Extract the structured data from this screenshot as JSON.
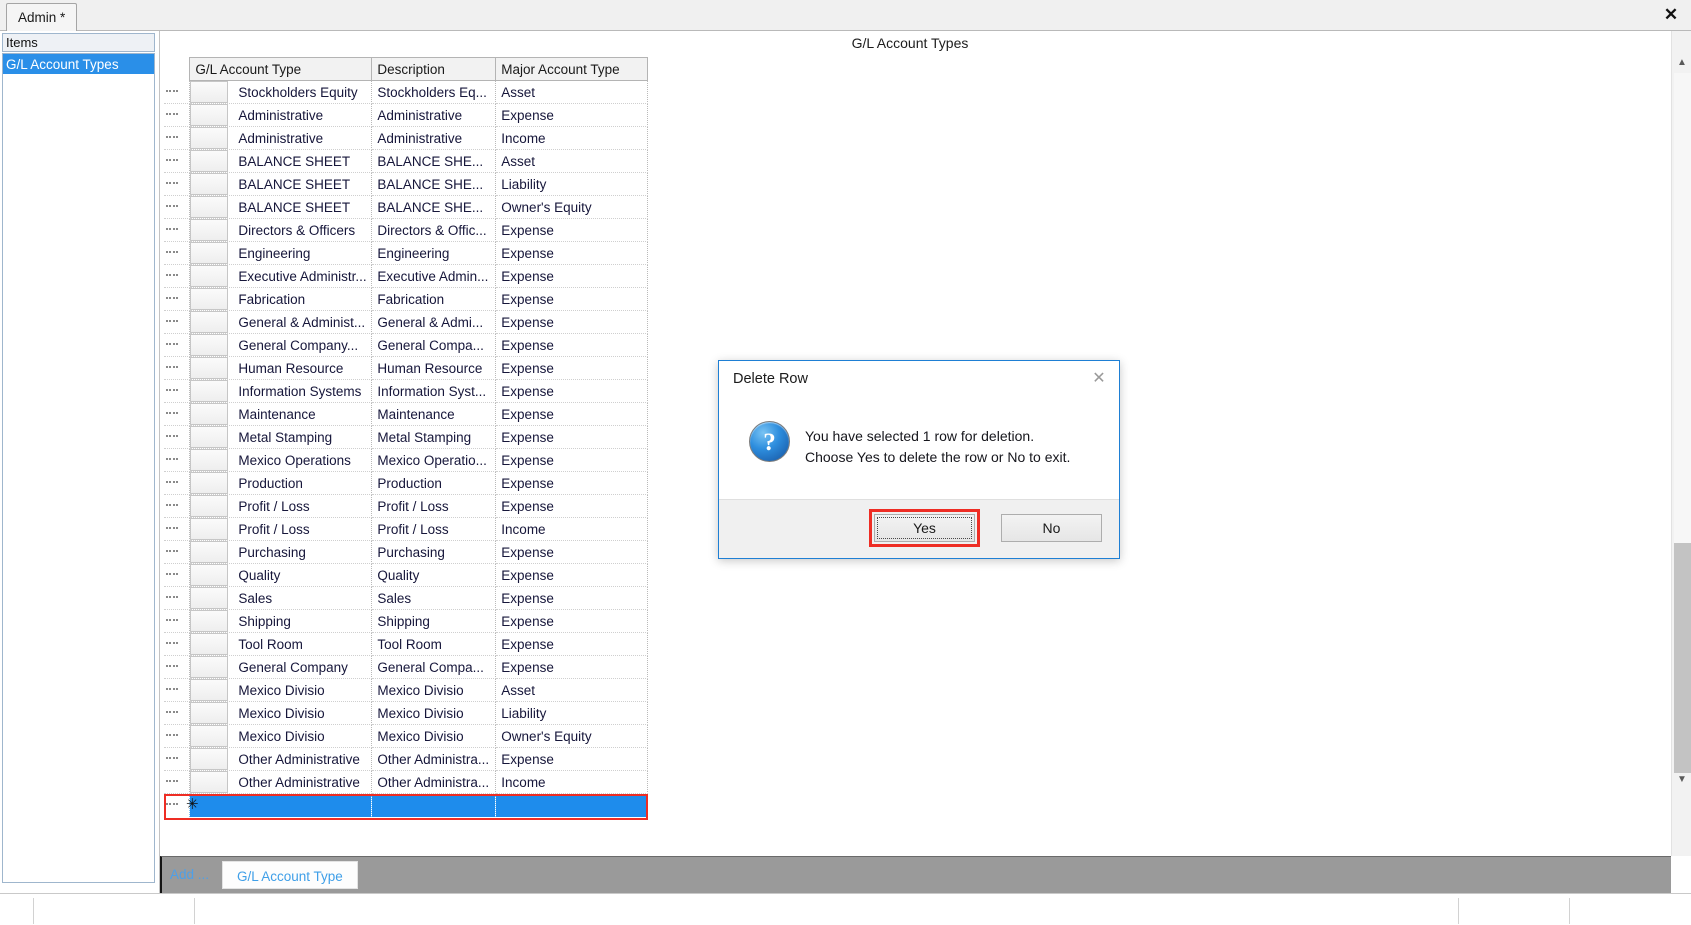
{
  "window": {
    "tab_label": "Admin *",
    "close_icon": "close-icon"
  },
  "sidebar": {
    "header": "Items",
    "items": [
      {
        "label": "G/L Account Types",
        "selected": true
      }
    ]
  },
  "main": {
    "title": "G/L Account Types"
  },
  "grid": {
    "columns": [
      "G/L Account Type",
      "Description",
      "Major Account Type"
    ],
    "rows": [
      {
        "type": "Stockholders Equity",
        "description": "Stockholders Eq...",
        "major": "Asset"
      },
      {
        "type": "Administrative",
        "description": "Administrative",
        "major": "Expense"
      },
      {
        "type": "Administrative",
        "description": "Administrative",
        "major": "Income"
      },
      {
        "type": "BALANCE SHEET",
        "description": "BALANCE  SHE...",
        "major": "Asset"
      },
      {
        "type": "BALANCE SHEET",
        "description": "BALANCE  SHE...",
        "major": "Liability"
      },
      {
        "type": "BALANCE SHEET",
        "description": "BALANCE  SHE...",
        "major": "Owner's Equity"
      },
      {
        "type": "Directors & Officers",
        "description": "Directors & Offic...",
        "major": "Expense"
      },
      {
        "type": "Engineering",
        "description": "Engineering",
        "major": "Expense"
      },
      {
        "type": "Executive Administr...",
        "description": "Executive Admin...",
        "major": "Expense"
      },
      {
        "type": "Fabrication",
        "description": "Fabrication",
        "major": "Expense"
      },
      {
        "type": "General & Administ...",
        "description": "General & Admi...",
        "major": "Expense"
      },
      {
        "type": "General Company...",
        "description": "General  Compa...",
        "major": "Expense"
      },
      {
        "type": "Human Resource",
        "description": "Human Resource",
        "major": "Expense"
      },
      {
        "type": "Information Systems",
        "description": "Information  Syst...",
        "major": "Expense"
      },
      {
        "type": "Maintenance",
        "description": "Maintenance",
        "major": "Expense"
      },
      {
        "type": "Metal Stamping",
        "description": "Metal Stamping",
        "major": "Expense"
      },
      {
        "type": "Mexico Operations",
        "description": "Mexico Operatio...",
        "major": "Expense"
      },
      {
        "type": "Production",
        "description": "Production",
        "major": "Expense"
      },
      {
        "type": "Profit / Loss",
        "description": "Profit / Loss",
        "major": "Expense"
      },
      {
        "type": "Profit / Loss",
        "description": "Profit / Loss",
        "major": "Income"
      },
      {
        "type": "Purchasing",
        "description": "Purchasing",
        "major": "Expense"
      },
      {
        "type": "Quality",
        "description": "Quality",
        "major": "Expense"
      },
      {
        "type": "Sales",
        "description": "Sales",
        "major": "Expense"
      },
      {
        "type": "Shipping",
        "description": "Shipping",
        "major": "Expense"
      },
      {
        "type": "Tool Room",
        "description": "Tool Room",
        "major": "Expense"
      },
      {
        "type": "General Company",
        "description": "General  Compa...",
        "major": "Expense"
      },
      {
        "type": "Mexico Divisio",
        "description": "Mexico Divisio",
        "major": "Asset"
      },
      {
        "type": "Mexico Divisio",
        "description": "Mexico Divisio",
        "major": "Liability"
      },
      {
        "type": "Mexico Divisio",
        "description": "Mexico Divisio",
        "major": "Owner's Equity"
      },
      {
        "type": "Other Administrative",
        "description": "Other Administra...",
        "major": "Expense"
      },
      {
        "type": "Other Administrative",
        "description": "Other Administra...",
        "major": "Income"
      }
    ],
    "new_row": {
      "type": "",
      "description": "",
      "major": "",
      "marker": "✳"
    }
  },
  "addbar": {
    "add_label": "Add ...",
    "chip_label": "G/L Account Type"
  },
  "dialog": {
    "title": "Delete Row",
    "close_icon": "close-icon",
    "icon": "question-icon",
    "icon_glyph": "?",
    "message_line1": "You have selected 1 row for deletion.",
    "message_line2": "Choose Yes to delete the row or No to exit.",
    "yes_label": "Yes",
    "no_label": "No",
    "focused_button": "Yes"
  },
  "colors": {
    "selection_blue": "#1e8cec",
    "highlight_red": "#ee2d24",
    "dialog_border": "#1e7fd4",
    "link_blue": "#3f9fe8",
    "addbar_gray": "#9a9a9a"
  },
  "statusbar": {
    "cell_a": "",
    "cell_b": "",
    "cell_c": "",
    "cell_d": "",
    "cell_e": ""
  }
}
